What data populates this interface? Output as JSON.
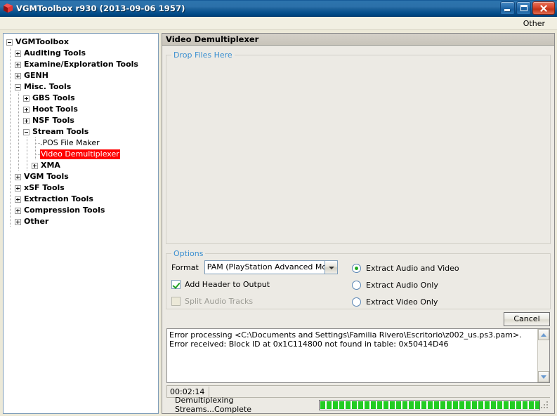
{
  "window": {
    "title": "VGMToolbox r930 (2013-09-06 1957)",
    "icon": "red-box-icon",
    "minimize_label": "Minimize",
    "maximize_label": "Maximize",
    "close_label": "Close"
  },
  "menubar": {
    "items": [
      {
        "label": "Other"
      }
    ]
  },
  "tree": {
    "nodes": [
      {
        "label": "VGMToolbox",
        "depth": 0,
        "state": "expanded",
        "selected": false
      },
      {
        "label": "Auditing Tools",
        "depth": 1,
        "state": "collapsed",
        "selected": false
      },
      {
        "label": "Examine/Exploration Tools",
        "depth": 1,
        "state": "collapsed",
        "selected": false
      },
      {
        "label": "GENH",
        "depth": 1,
        "state": "collapsed",
        "selected": false
      },
      {
        "label": "Misc. Tools",
        "depth": 1,
        "state": "expanded",
        "selected": false
      },
      {
        "label": "GBS Tools",
        "depth": 2,
        "state": "collapsed",
        "selected": false
      },
      {
        "label": "Hoot Tools",
        "depth": 2,
        "state": "collapsed",
        "selected": false
      },
      {
        "label": "NSF Tools",
        "depth": 2,
        "state": "collapsed",
        "selected": false
      },
      {
        "label": "Stream Tools",
        "depth": 2,
        "state": "expanded",
        "selected": false
      },
      {
        "label": ".POS File Maker",
        "depth": 3,
        "state": "leaf",
        "selected": false
      },
      {
        "label": "Video Demultiplexer",
        "depth": 3,
        "state": "leaf",
        "selected": true
      },
      {
        "label": "XMA",
        "depth": 3,
        "state": "collapsed",
        "selected": false
      },
      {
        "label": "VGM Tools",
        "depth": 1,
        "state": "collapsed",
        "selected": false
      },
      {
        "label": "xSF Tools",
        "depth": 1,
        "state": "collapsed",
        "selected": false
      },
      {
        "label": "Extraction Tools",
        "depth": 1,
        "state": "collapsed",
        "selected": false
      },
      {
        "label": "Compression Tools",
        "depth": 1,
        "state": "collapsed",
        "selected": false
      },
      {
        "label": "Other",
        "depth": 1,
        "state": "collapsed",
        "selected": false
      }
    ]
  },
  "panel": {
    "header": "Video Demultiplexer",
    "dropzone_label": "Drop Files Here",
    "options": {
      "legend": "Options",
      "format_label": "Format",
      "format_value": "PAM (PlayStation Advanced Movie)",
      "checkboxes": [
        {
          "label": "Add Header to Output",
          "checked": true,
          "enabled": true
        },
        {
          "label": "Split Audio Tracks",
          "checked": false,
          "enabled": false
        }
      ],
      "radios": [
        {
          "label": "Extract Audio and Video",
          "selected": true
        },
        {
          "label": "Extract Audio Only",
          "selected": false
        },
        {
          "label": "Extract Video Only",
          "selected": false
        }
      ]
    },
    "cancel_label": "Cancel",
    "log_text": "Error processing <C:\\Documents and Settings\\Familia Rivero\\Escritorio\\z002_us.ps3.pam>.  Error received: Block ID at 0x1C114800 not found in table: 0x50414D46",
    "timer": "00:02:14",
    "status_text": "Demultiplexing Streams...Complete",
    "progress_percent": 100
  },
  "colors": {
    "selection_red": "#ff0000",
    "progress_green": "#22cc22",
    "legend_blue": "#3a8fd0",
    "titlebar_blue": "#2b70a9"
  }
}
